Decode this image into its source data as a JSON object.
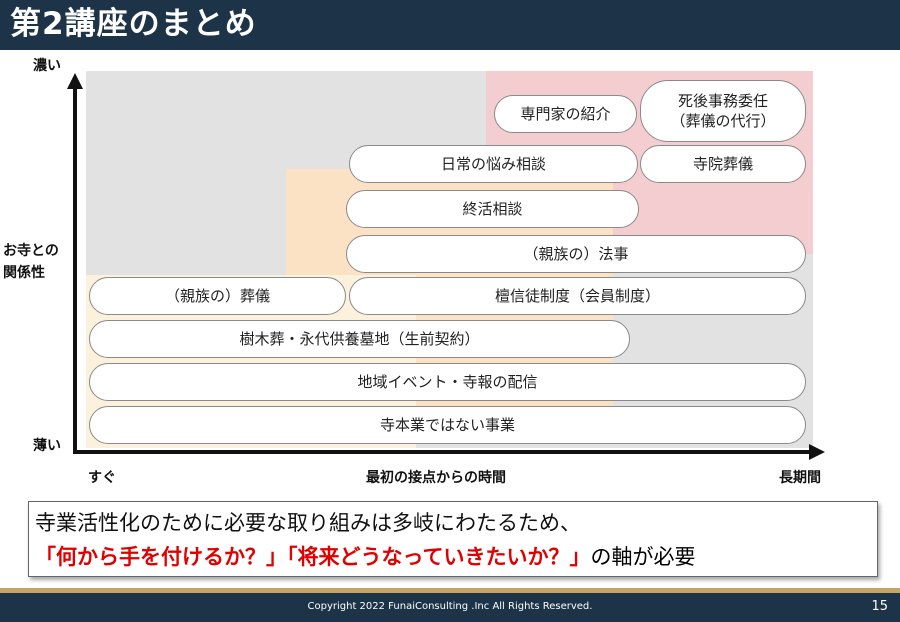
{
  "title": "第2講座のまとめ",
  "axes": {
    "y_top": "濃い",
    "y_mid": "お寺との\n関係性",
    "y_bottom": "薄い",
    "x_left": "すぐ",
    "x_mid": "最初の接点からの時間",
    "x_right": "長期間"
  },
  "items": {
    "senmonka": "専門家の紹介",
    "shigo_line1": "死後事務委任",
    "shigo_line2": "（葬儀の代行）",
    "nichijo": "日常の悩み相談",
    "jiin_sogi": "寺院葬儀",
    "shukatsu": "終活相談",
    "shinzoku_hoji": "（親族の）法事",
    "shinzoku_sogi": "（親族の）葬儀",
    "danshinto": "檀信徒制度（会員制度）",
    "jumokuso": "樹木葬・永代供養墓地（生前契約）",
    "chiiki": "地域イベント・寺報の配信",
    "honsho_igai": "寺本業ではない事業"
  },
  "summary": {
    "line1": "寺業活性化のために必要な取り組みは多岐にわたるため、",
    "line2_red1": "「何から手を付けるか？」",
    "line2_red2": "「将来どうなっていきたいか？」",
    "line2_tail": "の軸が必要"
  },
  "footer": {
    "copyright": "Copyright 2022 FunaiConsulting .Inc All Rights Reserved.",
    "page": "15"
  },
  "colors": {
    "header": "#1d3347",
    "gray_zone": "#e2e2e2",
    "pink_zone": "#f4cdd0",
    "orange_zone": "#fbe2c4",
    "cream_zone": "#fbf1dc",
    "accent_red": "#e00000",
    "gold_bar": "#c8a464"
  }
}
